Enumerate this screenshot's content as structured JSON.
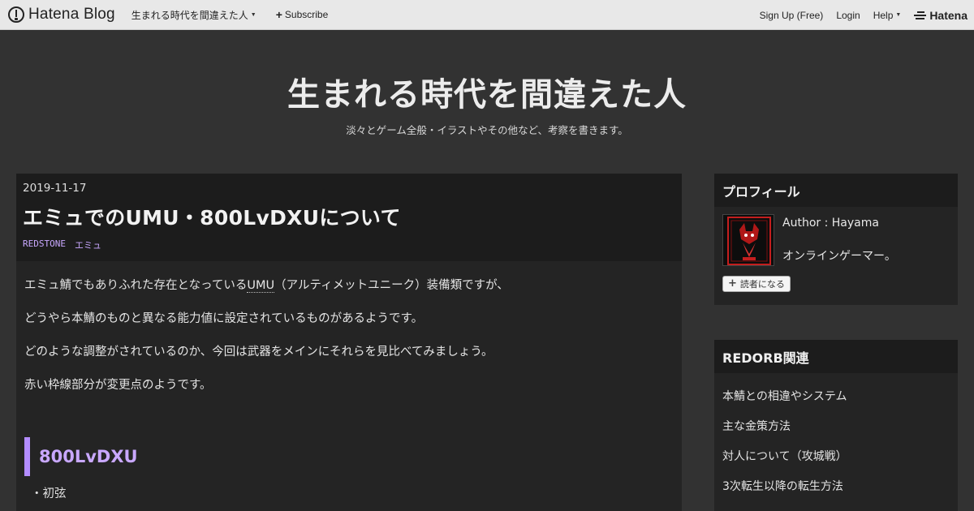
{
  "topbar": {
    "brand": "Hatena Blog",
    "blog_name_menu": "生まれる時代を間違えた人",
    "subscribe": "Subscribe",
    "signup": "Sign Up (Free)",
    "login": "Login",
    "help": "Help",
    "hatena": "Hatena"
  },
  "header": {
    "title": "生まれる時代を間違えた人",
    "description": "淡々とゲーム全般・イラストやその他など、考察を書きます。"
  },
  "article": {
    "date": "2019-11-17",
    "title": "エミュでのUMU・800LvDXUについて",
    "categories": [
      "REDSTONE",
      "エミュ"
    ],
    "para1_prefix": "エミュ鯖でもありふれた存在となっている",
    "para1_abbr": "UMU",
    "para1_suffix": "（アルティメットユニーク）装備類ですが、",
    "para2": "どうやら本鯖のものと異なる能力値に設定されているものがあるようです。",
    "para3": "どのような調整がされているのか、今回は武器をメインにそれらを見比べてみましょう。",
    "para4": "赤い枠線部分が変更点のようです。",
    "section_heading": "800LvDXU",
    "list_item": "・初弦"
  },
  "sidebar": {
    "profile": {
      "title": "プロフィール",
      "author": "Author : Hayama",
      "text": "オンラインゲーマー。",
      "follow": "読者になる"
    },
    "links": {
      "title": "REDORB関連",
      "items": [
        "本鯖との相違やシステム",
        "主な金策方法",
        "対人について（攻城戦）",
        "3次転生以降の転生方法"
      ]
    }
  },
  "colors": {
    "accent": "#b38cff",
    "background": "#323232",
    "panel": "#242424"
  }
}
